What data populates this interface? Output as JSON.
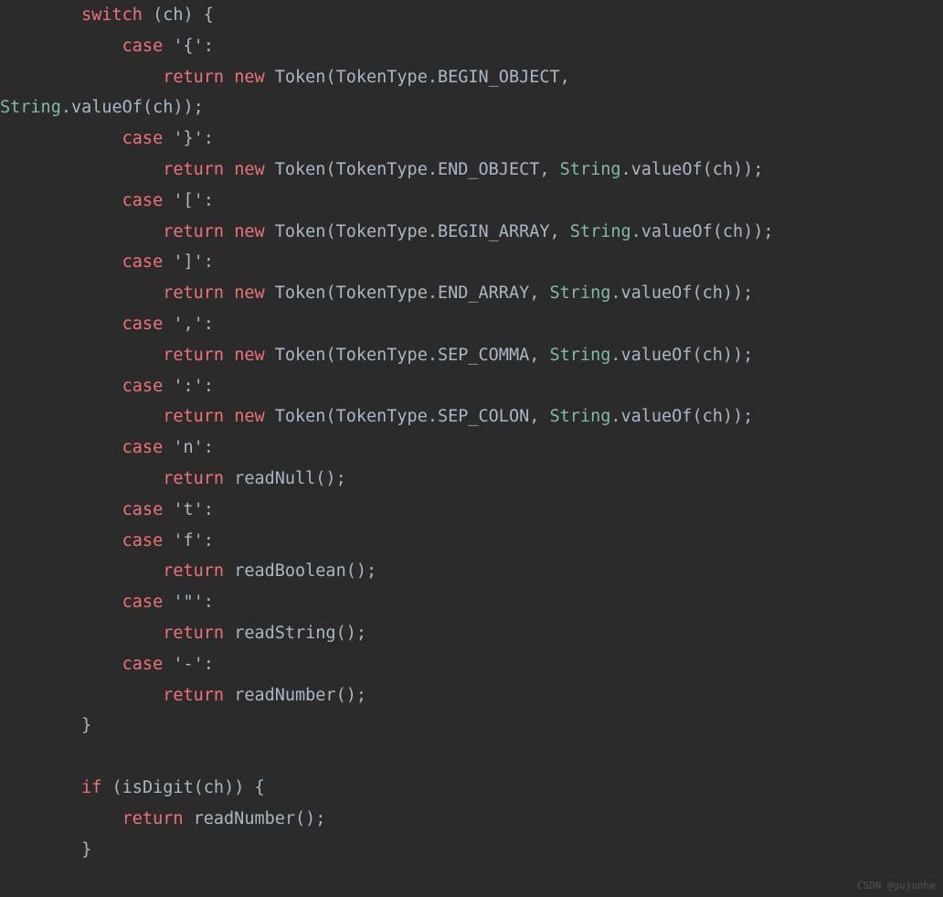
{
  "code": {
    "l1": {
      "sw": "switch",
      "ch": "ch"
    },
    "l2": {
      "cs": "case",
      "lit": "'{'"
    },
    "l3": {
      "ret": "return",
      "nw": "new",
      "tok": "Token",
      "tt": "TokenType",
      "tv": "BEGIN_OBJECT"
    },
    "l4": {
      "str": "String",
      "vo": "valueOf",
      "ch": "ch"
    },
    "l5": {
      "cs": "case",
      "lit": "'}'"
    },
    "l6": {
      "ret": "return",
      "nw": "new",
      "tok": "Token",
      "tt": "TokenType",
      "tv": "END_OBJECT",
      "str": "String",
      "vo": "valueOf",
      "ch": "ch"
    },
    "l7": {
      "cs": "case",
      "lit": "'['"
    },
    "l8": {
      "ret": "return",
      "nw": "new",
      "tok": "Token",
      "tt": "TokenType",
      "tv": "BEGIN_ARRAY",
      "str": "String",
      "vo": "valueOf",
      "ch": "ch"
    },
    "l9": {
      "cs": "case",
      "lit": "']'"
    },
    "l10": {
      "ret": "return",
      "nw": "new",
      "tok": "Token",
      "tt": "TokenType",
      "tv": "END_ARRAY",
      "str": "String",
      "vo": "valueOf",
      "ch": "ch"
    },
    "l11": {
      "cs": "case",
      "lit": "','"
    },
    "l12": {
      "ret": "return",
      "nw": "new",
      "tok": "Token",
      "tt": "TokenType",
      "tv": "SEP_COMMA",
      "str": "String",
      "vo": "valueOf",
      "ch": "ch"
    },
    "l13": {
      "cs": "case",
      "lit": "':'"
    },
    "l14": {
      "ret": "return",
      "nw": "new",
      "tok": "Token",
      "tt": "TokenType",
      "tv": "SEP_COLON",
      "str": "String",
      "vo": "valueOf",
      "ch": "ch"
    },
    "l15": {
      "cs": "case",
      "lit": "'n'"
    },
    "l16": {
      "ret": "return",
      "fn": "readNull"
    },
    "l17": {
      "cs": "case",
      "lit": "'t'"
    },
    "l18": {
      "cs": "case",
      "lit": "'f'"
    },
    "l19": {
      "ret": "return",
      "fn": "readBoolean"
    },
    "l20": {
      "cs": "case",
      "lit": "'\"'"
    },
    "l21": {
      "ret": "return",
      "fn": "readString"
    },
    "l22": {
      "cs": "case",
      "lit": "'-'"
    },
    "l23": {
      "ret": "return",
      "fn": "readNumber"
    },
    "l25": {
      "ifk": "if",
      "fn": "isDigit",
      "ch": "ch"
    },
    "l26": {
      "ret": "return",
      "fn": "readNumber"
    }
  },
  "watermark": "CSDN @gujunhe"
}
